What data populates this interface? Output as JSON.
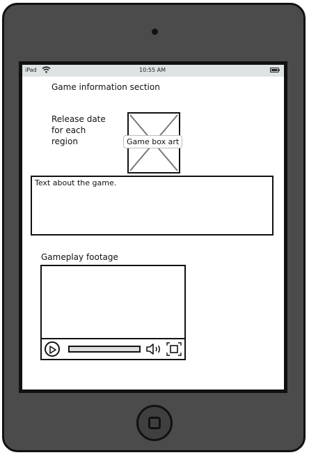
{
  "status_bar": {
    "device": "iPad",
    "time": "10:55 AM",
    "wifi_icon": "wifi-icon",
    "battery_icon": "battery-icon"
  },
  "content": {
    "section_title": "Game information section",
    "release_info": "Release date for each region",
    "box_art_label": "Game box art",
    "about_text": "Text about the game.",
    "footage_label": "Gameplay footage"
  },
  "video_player": {
    "play_icon": "play-icon",
    "volume_icon": "volume-icon",
    "fullscreen_icon": "fullscreen-icon",
    "progress": 0
  },
  "device": {
    "home_icon": "home-button-icon"
  }
}
